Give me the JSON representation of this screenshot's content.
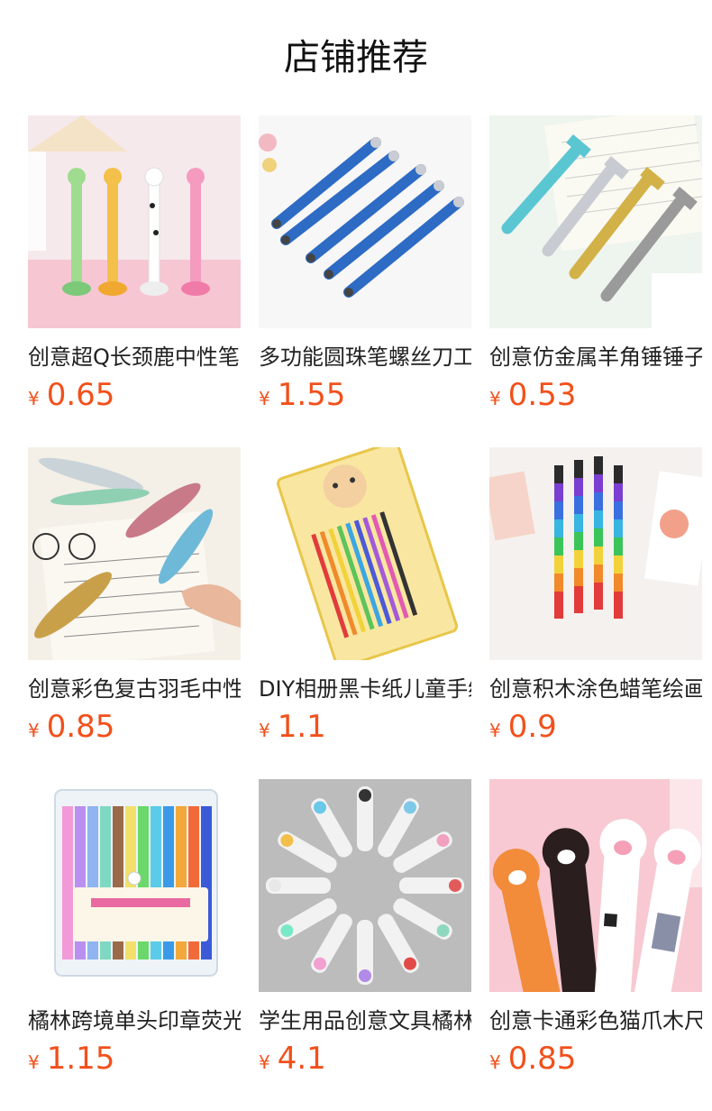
{
  "header": {
    "title": "店铺推荐"
  },
  "products": [
    {
      "name": "创意超Q长颈鹿中性笔",
      "currency": "¥",
      "price": "0.65",
      "image": "giraffe-pens"
    },
    {
      "name": "多功能圆珠笔螺丝刀工具笔",
      "currency": "¥",
      "price": "1.55",
      "image": "tool-pens"
    },
    {
      "name": "创意仿金属羊角锤锤子笔",
      "currency": "¥",
      "price": "0.53",
      "image": "hammer-pens"
    },
    {
      "name": "创意彩色复古羽毛中性笔",
      "currency": "¥",
      "price": "0.85",
      "image": "feather-pens"
    },
    {
      "name": "DIY相册黑卡纸儿童手绘笔",
      "currency": "¥",
      "price": "1.1",
      "image": "gel-pen-pack"
    },
    {
      "name": "创意积木涂色蜡笔绘画笔",
      "currency": "¥",
      "price": "0.9",
      "image": "block-crayons"
    },
    {
      "name": "橘林跨境单头印章荧光笔",
      "currency": "¥",
      "price": "1.15",
      "image": "stamp-highlighters"
    },
    {
      "name": "学生用品创意文具橘林修正带",
      "currency": "¥",
      "price": "4.1",
      "image": "correction-tapes"
    },
    {
      "name": "创意卡通彩色猫爪木尺",
      "currency": "¥",
      "price": "0.85",
      "image": "cat-paw-rulers"
    }
  ]
}
